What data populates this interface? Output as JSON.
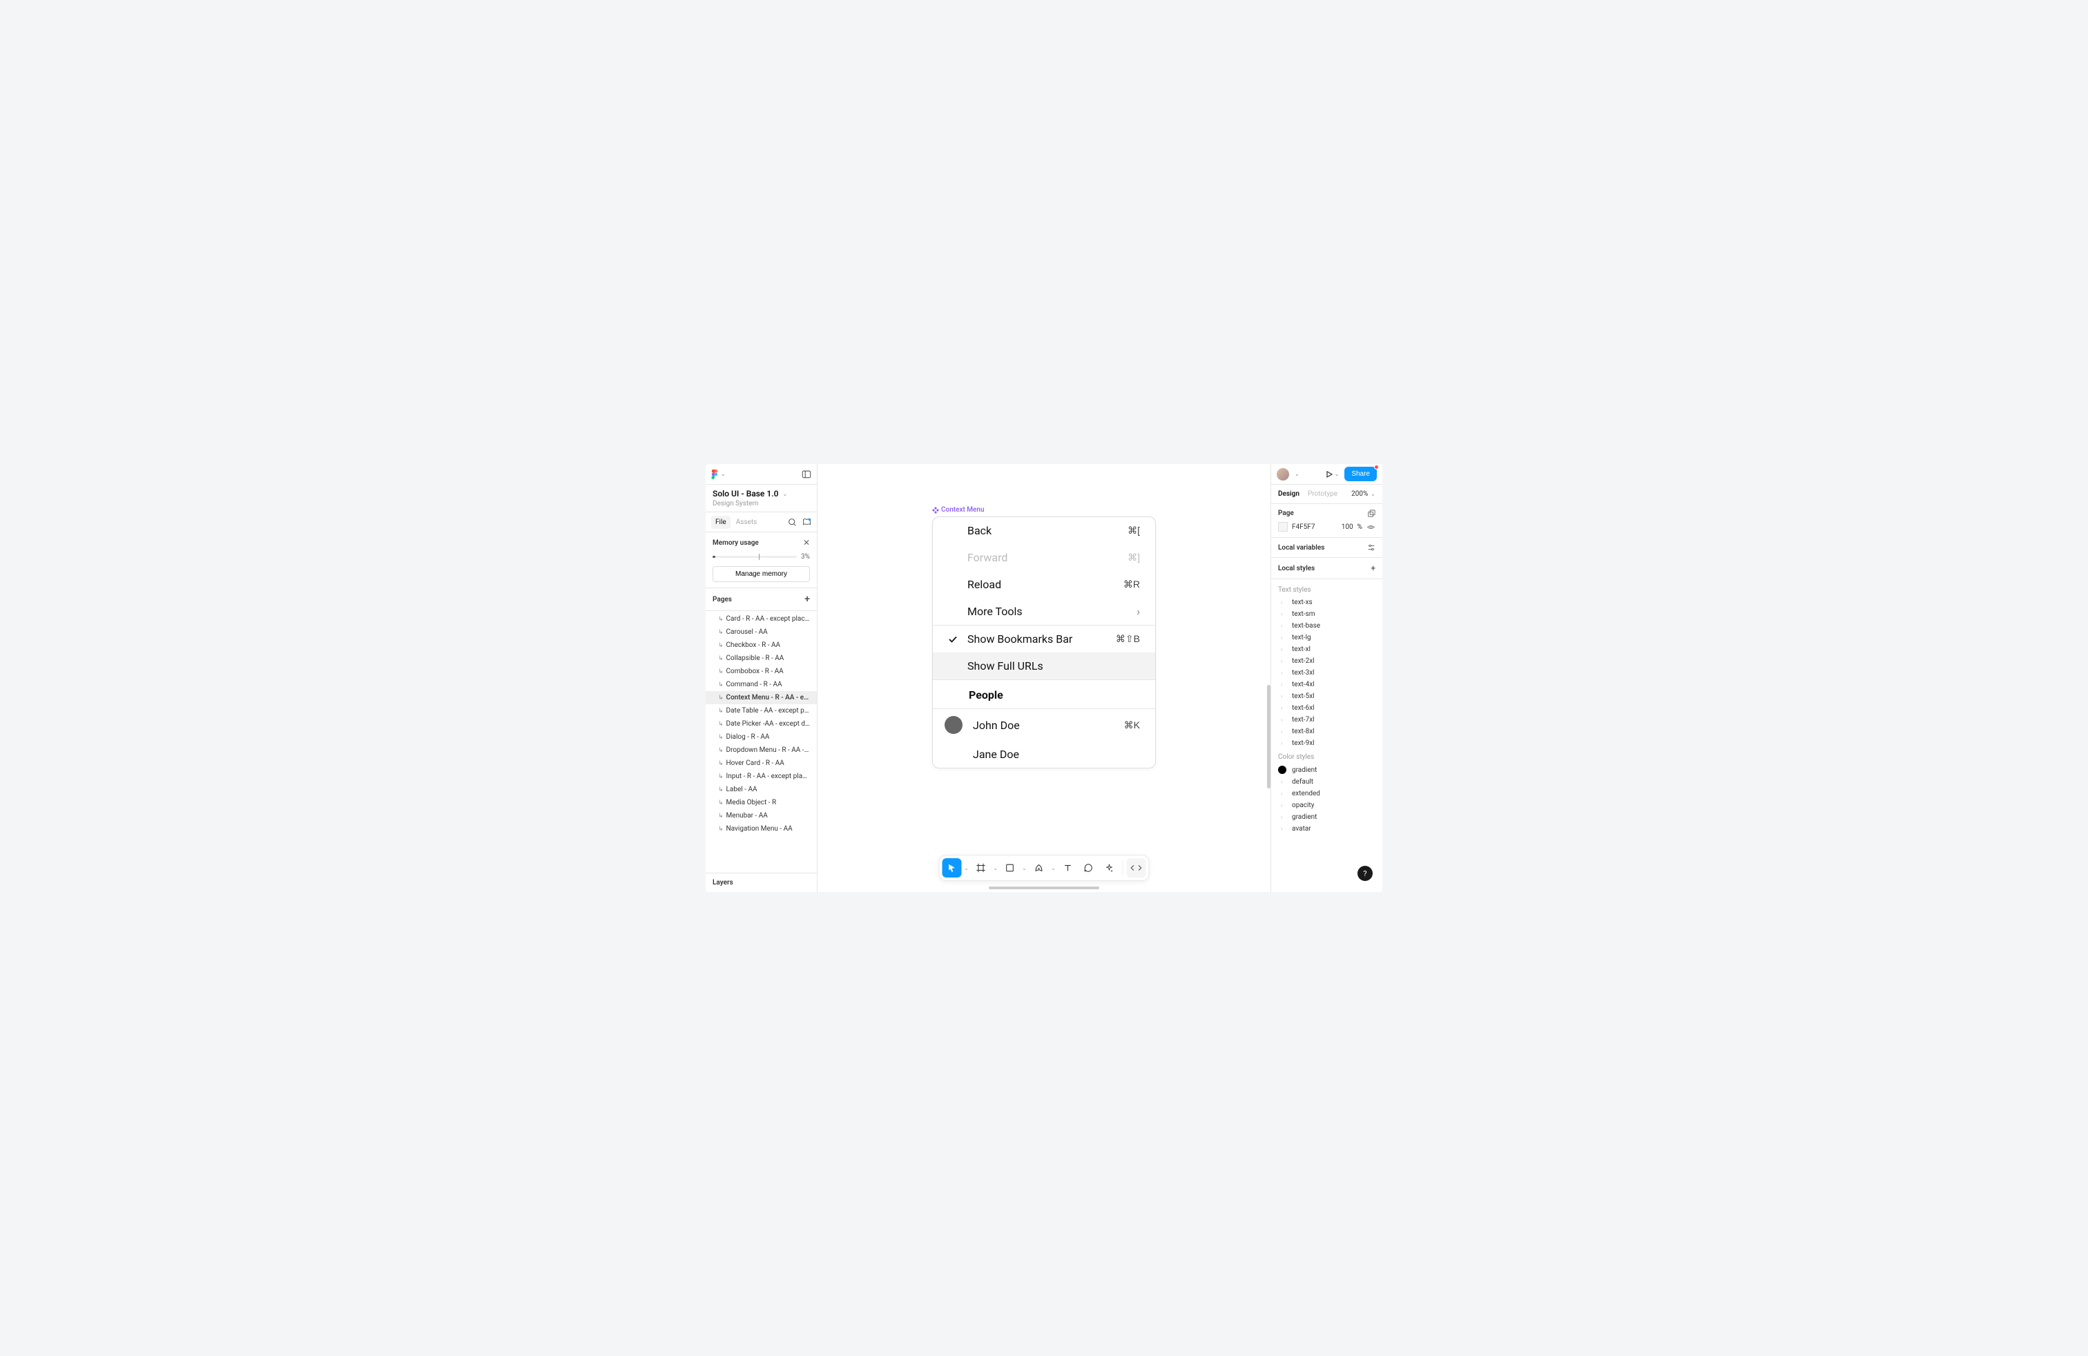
{
  "leftPanel": {
    "fileTitle": "Solo UI - Base 1.0",
    "fileSubtitle": "Design System",
    "tabs": {
      "file": "File",
      "assets": "Assets"
    },
    "memory": {
      "title": "Memory usage",
      "pct": "3%",
      "fillWidth": "3%",
      "manage": "Manage memory"
    },
    "pagesHeader": "Pages",
    "layersHeader": "Layers",
    "pages": [
      {
        "label": "Card - R - AA - except placehol…",
        "selected": false
      },
      {
        "label": "Carousel  - AA",
        "selected": false
      },
      {
        "label": "Checkbox - R - AA",
        "selected": false
      },
      {
        "label": "Collapsible - R - AA",
        "selected": false
      },
      {
        "label": "Combobox - R - AA",
        "selected": false
      },
      {
        "label": "Command - R - AA",
        "selected": false
      },
      {
        "label": "Context Menu - R - AA - except…",
        "selected": true
      },
      {
        "label": "Date Table - AA - except placeh…",
        "selected": false
      },
      {
        "label": "Date Picker -AA - except disabl…",
        "selected": false
      },
      {
        "label": "Dialog - R - AA",
        "selected": false
      },
      {
        "label": "Dropdown Menu - R - AA - exce…",
        "selected": false
      },
      {
        "label": "Hover Card - R - AA",
        "selected": false
      },
      {
        "label": "Input - R - AA - except placehol…",
        "selected": false
      },
      {
        "label": "Label - AA",
        "selected": false
      },
      {
        "label": "Media Object - R",
        "selected": false
      },
      {
        "label": "Menubar - AA",
        "selected": false
      },
      {
        "label": "Navigation Menu - AA",
        "selected": false
      }
    ]
  },
  "canvas": {
    "frameLabel": "Context Menu",
    "menu": {
      "groups": [
        [
          {
            "type": "item",
            "label": "Back",
            "shortcut": "⌘[",
            "disabled": false
          },
          {
            "type": "item",
            "label": "Forward",
            "shortcut": "⌘]",
            "disabled": true
          },
          {
            "type": "item",
            "label": "Reload",
            "shortcut": "⌘R",
            "disabled": false
          },
          {
            "type": "submenu",
            "label": "More Tools"
          }
        ],
        [
          {
            "type": "checkbox",
            "label": "Show Bookmarks Bar",
            "shortcut": "⌘⇧B",
            "checked": true
          },
          {
            "type": "item",
            "label": "Show Full URLs",
            "hover": true
          }
        ],
        [
          {
            "type": "header",
            "label": "People"
          }
        ],
        [
          {
            "type": "radio",
            "label": "John Doe",
            "shortcut": "⌘K",
            "selected": true
          },
          {
            "type": "item",
            "label": "Jane Doe"
          }
        ]
      ]
    }
  },
  "rightPanel": {
    "tabs": {
      "design": "Design",
      "prototype": "Prototype"
    },
    "zoom": "200%",
    "share": "Share",
    "pageSection": {
      "title": "Page",
      "color": "F4F5F7",
      "opacity": "100",
      "unit": "%"
    },
    "localVars": "Local variables",
    "localStyles": "Local styles",
    "textStylesLabel": "Text styles",
    "textStyles": [
      "text-xs",
      "text-sm",
      "text-base",
      "text-lg",
      "text-xl",
      "text-2xl",
      "text-3xl",
      "text-4xl",
      "text-5xl",
      "text-6xl",
      "text-7xl",
      "text-8xl",
      "text-9xl"
    ],
    "colorStylesLabel": "Color styles",
    "colorStyles": [
      {
        "label": "gradient",
        "hasDot": true
      },
      {
        "label": "default"
      },
      {
        "label": "extended"
      },
      {
        "label": "opacity"
      },
      {
        "label": "gradient"
      },
      {
        "label": "avatar"
      }
    ],
    "help": "?"
  }
}
